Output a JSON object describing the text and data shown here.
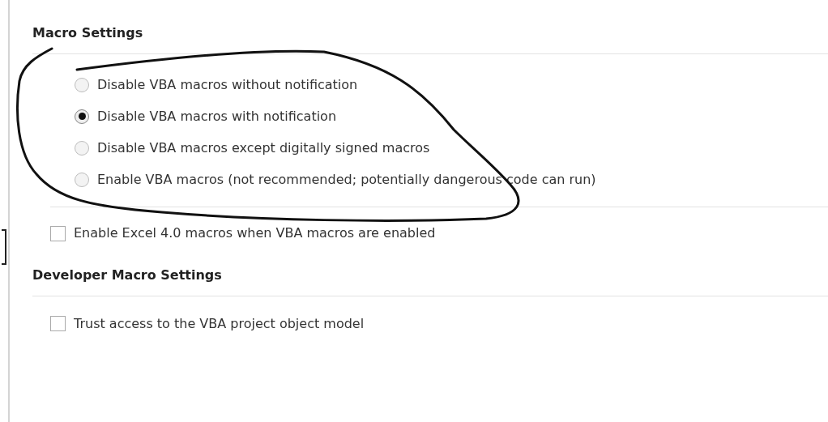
{
  "sections": [
    {
      "title": "Macro Settings",
      "items": [
        {
          "kind": "radio",
          "label": "Disable VBA macros without notification",
          "selected": false
        },
        {
          "kind": "radio",
          "label": "Disable VBA macros with notification",
          "selected": true
        },
        {
          "kind": "radio",
          "label": "Disable VBA macros except digitally signed macros",
          "selected": false
        },
        {
          "kind": "radio",
          "label": "Enable VBA macros (not recommended; potentially dangerous code can run)",
          "selected": false
        },
        {
          "kind": "divider"
        },
        {
          "kind": "checkbox",
          "label": "Enable Excel 4.0 macros when VBA macros are enabled",
          "checked": false
        }
      ]
    },
    {
      "title": "Developer Macro Settings",
      "items": [
        {
          "kind": "checkbox",
          "label": "Trust access to the VBA project object model",
          "checked": false
        }
      ]
    }
  ]
}
